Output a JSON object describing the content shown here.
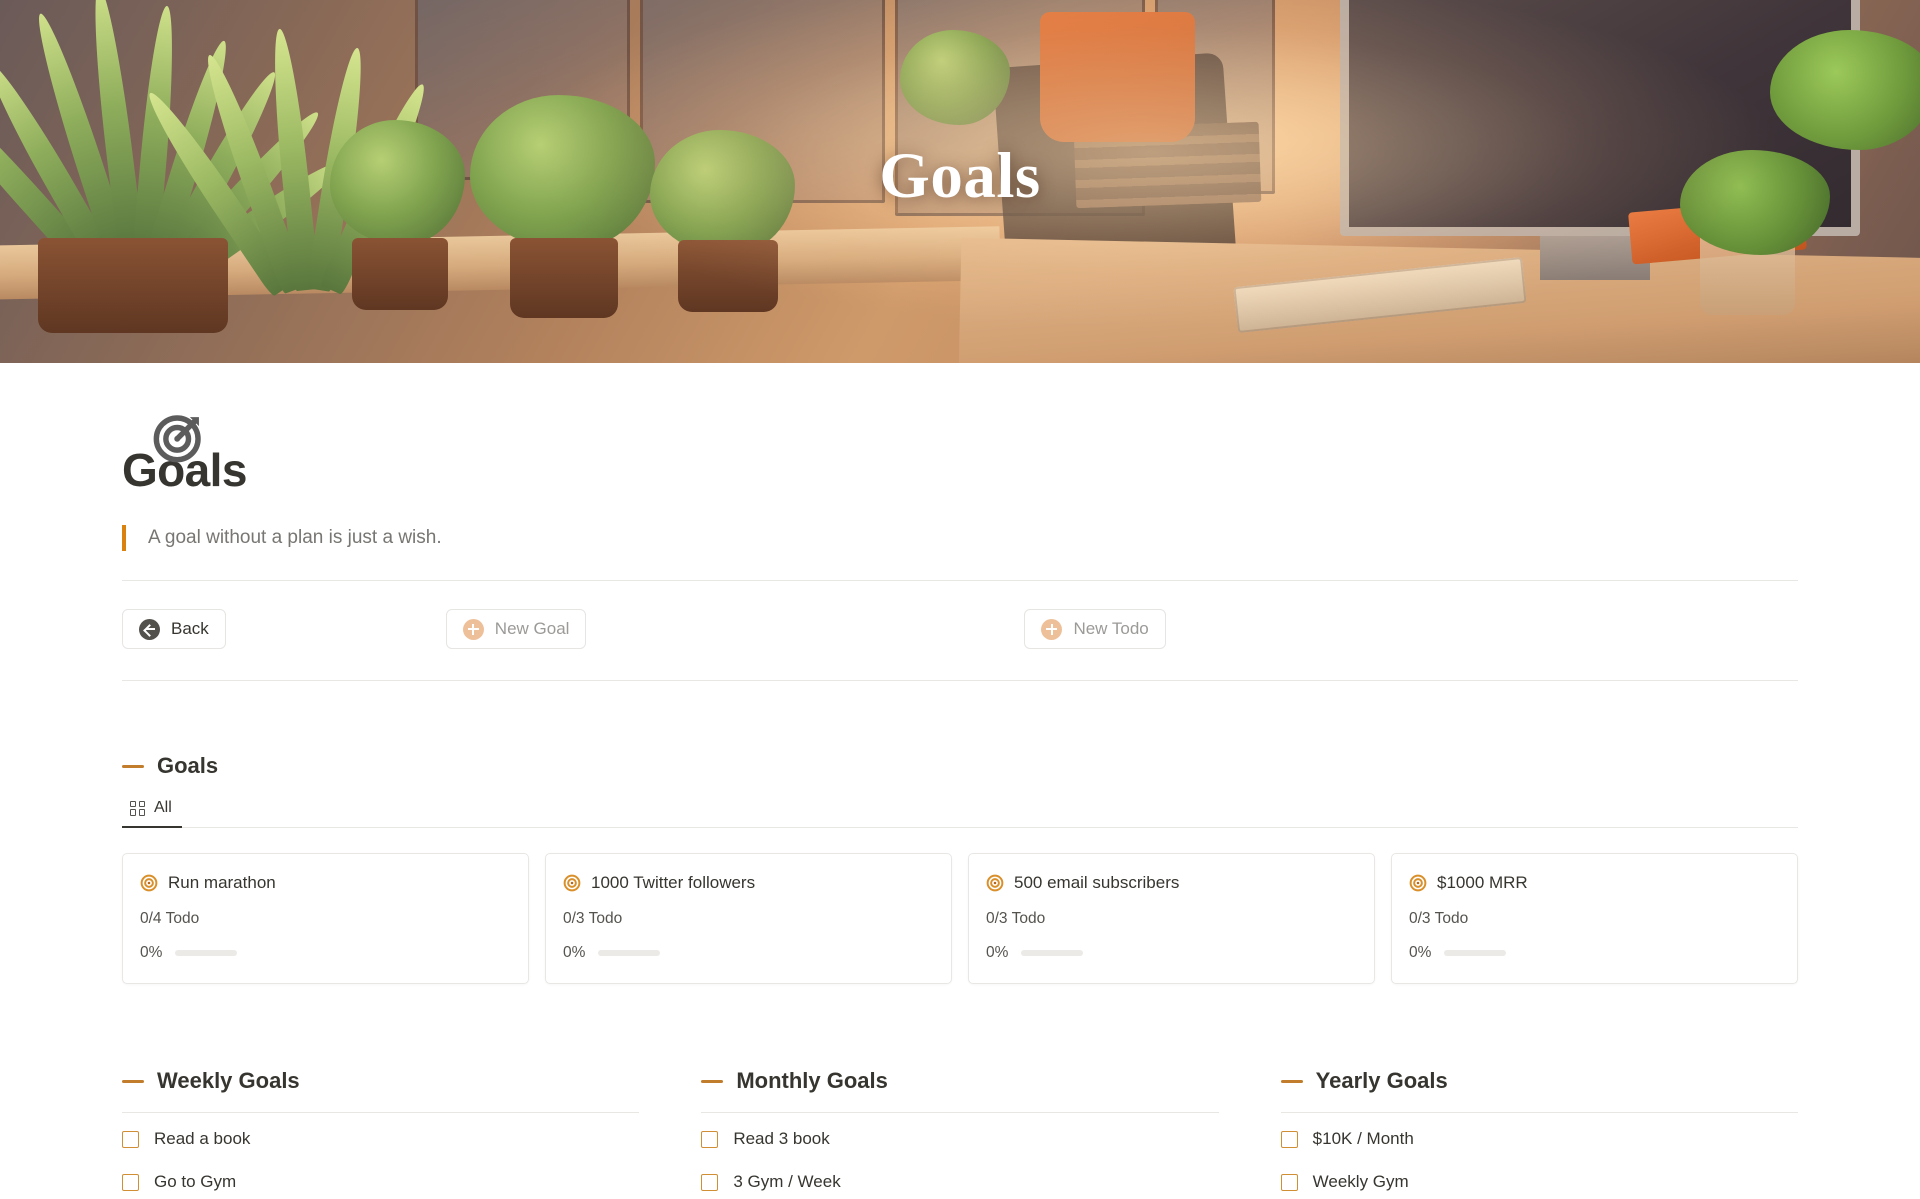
{
  "hero": {
    "title": "Goals"
  },
  "page": {
    "icon_name": "target-icon",
    "title": "Goals",
    "quote": "A goal without a plan is just a wish."
  },
  "toolbar": {
    "back_label": "Back",
    "new_goal_label": "New Goal",
    "new_todo_label": "New Todo"
  },
  "goals_section": {
    "heading": "Goals",
    "tab_all_label": "All",
    "cards": [
      {
        "title": "Run marathon",
        "todo": "0/4 Todo",
        "percent": "0%",
        "progress": 0
      },
      {
        "title": "1000 Twitter followers",
        "todo": "0/3 Todo",
        "percent": "0%",
        "progress": 0
      },
      {
        "title": "500 email subscribers",
        "todo": "0/3 Todo",
        "percent": "0%",
        "progress": 0
      },
      {
        "title": "$1000 MRR",
        "todo": "0/3 Todo",
        "percent": "0%",
        "progress": 0
      }
    ]
  },
  "columns": [
    {
      "heading": "Weekly Goals",
      "items": [
        {
          "label": "Read a book",
          "checked": false
        },
        {
          "label": "Go to Gym",
          "checked": false
        }
      ]
    },
    {
      "heading": "Monthly Goals",
      "items": [
        {
          "label": "Read 3 book",
          "checked": false
        },
        {
          "label": "3 Gym / Week",
          "checked": false
        }
      ]
    },
    {
      "heading": "Yearly Goals",
      "items": [
        {
          "label": "$10K / Month",
          "checked": false
        },
        {
          "label": "Weekly Gym",
          "checked": false
        }
      ]
    }
  ],
  "colors": {
    "accent": "#c17d2b",
    "quote_bar": "#d9820f",
    "checkbox_border": "#d08f35",
    "text": "#37352f",
    "muted": "#9b9a97",
    "plus_icon": "#eec09a"
  }
}
